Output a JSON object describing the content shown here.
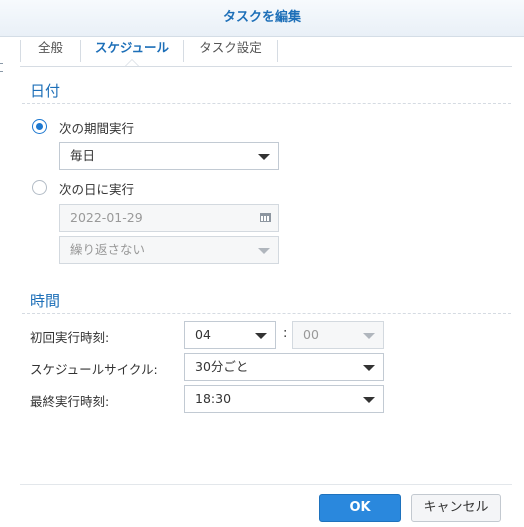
{
  "dialog": {
    "title": "タスクを編集"
  },
  "tabs": [
    {
      "label": "全般"
    },
    {
      "label": "スケジュール"
    },
    {
      "label": "タスク設定"
    }
  ],
  "date_section": {
    "title": "日付",
    "option_periodic": "次の期間実行",
    "periodic_value": "毎日",
    "option_specific": "次の日に実行",
    "date_value": "2022-01-29",
    "repeat_value": "繰り返さない"
  },
  "time_section": {
    "title": "時間",
    "first_run_label": "初回実行時刻:",
    "hour": "04",
    "colon": ":",
    "minute": "00",
    "cycle_label": "スケジュールサイクル:",
    "cycle_value": "30分ごと",
    "last_run_label": "最終実行時刻:",
    "last_run_value": "18:30"
  },
  "buttons": {
    "ok": "OK",
    "cancel": "キャンセル"
  },
  "colors": {
    "accent": "#1d6fb8",
    "primary_button": "#2a88dd"
  }
}
